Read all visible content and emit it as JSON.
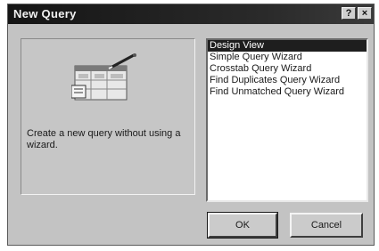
{
  "window": {
    "title": "New Query",
    "help_label": "?",
    "close_label": "×"
  },
  "left_panel": {
    "graphic_icon": "query-design-wizard-icon",
    "description": "Create a new query without using a wizard."
  },
  "query_list": {
    "items": [
      {
        "label": "Design View",
        "selected": true
      },
      {
        "label": "Simple Query Wizard",
        "selected": false
      },
      {
        "label": "Crosstab Query Wizard",
        "selected": false
      },
      {
        "label": "Find Duplicates Query Wizard",
        "selected": false
      },
      {
        "label": "Find Unmatched Query Wizard",
        "selected": false
      }
    ]
  },
  "buttons": {
    "ok_label": "OK",
    "cancel_label": "Cancel"
  }
}
